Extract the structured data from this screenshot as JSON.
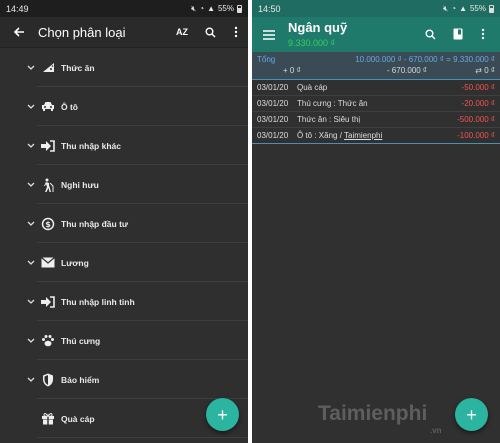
{
  "left_screen": {
    "status": {
      "time": "14:49",
      "battery": "55%"
    },
    "appbar": {
      "title": "Chọn phân loại",
      "sort_label": "AZ"
    },
    "categories": [
      {
        "label": "Thức ăn",
        "icon": "pizza-icon"
      },
      {
        "label": "Ô tô",
        "icon": "car-icon"
      },
      {
        "label": "Thu nhập khác",
        "icon": "sign-in-icon"
      },
      {
        "label": "Nghỉ hưu",
        "icon": "elderly-walker-icon"
      },
      {
        "label": "Thu nhập đầu tư",
        "icon": "dollar-refresh-icon"
      },
      {
        "label": "Lương",
        "icon": "envelope-icon"
      },
      {
        "label": "Thu nhập linh tinh",
        "icon": "sign-in-icon"
      },
      {
        "label": "Thú cưng",
        "icon": "paw-icon"
      },
      {
        "label": "Bảo hiểm",
        "icon": "shield-icon"
      },
      {
        "label": "Quà cáp",
        "icon": "gift-icon"
      }
    ],
    "fab": "+"
  },
  "right_screen": {
    "status": {
      "time": "14:50",
      "battery": "55%"
    },
    "appbar": {
      "title": "Ngân quỹ",
      "balance": "9.330.000 ₫"
    },
    "summary": {
      "label": "Tổng",
      "formula": "10.000.000 ₫ - 670.000 ₫ = 9.330.000 ₫",
      "income": "+ 0 ₫",
      "expense": "- 670.000 ₫",
      "transfer": "⇄ 0 ₫"
    },
    "transactions": [
      {
        "date": "03/01/20",
        "desc": "Quà cáp",
        "extra": "",
        "amount": "-50.000 ₫"
      },
      {
        "date": "03/01/20",
        "desc": "Thú cưng : Thức ăn",
        "extra": "",
        "amount": "-20.000 ₫"
      },
      {
        "date": "03/01/20",
        "desc": "Thức ăn : Siêu thị",
        "extra": "",
        "amount": "-500.000 ₫"
      },
      {
        "date": "03/01/20",
        "desc": "Ô tô : Xăng / ",
        "extra": "Taimienphi",
        "amount": "-100.000 ₫"
      }
    ],
    "fab": "+",
    "watermark": {
      "text": "Taimienphi",
      "suffix": ".vn"
    }
  },
  "colors": {
    "teal_bar": "#1f7a6c",
    "fab": "#2bb5a0",
    "balance_green": "#34d058",
    "amount_red": "#ef5350",
    "summary_blue": "#68a8e0"
  }
}
